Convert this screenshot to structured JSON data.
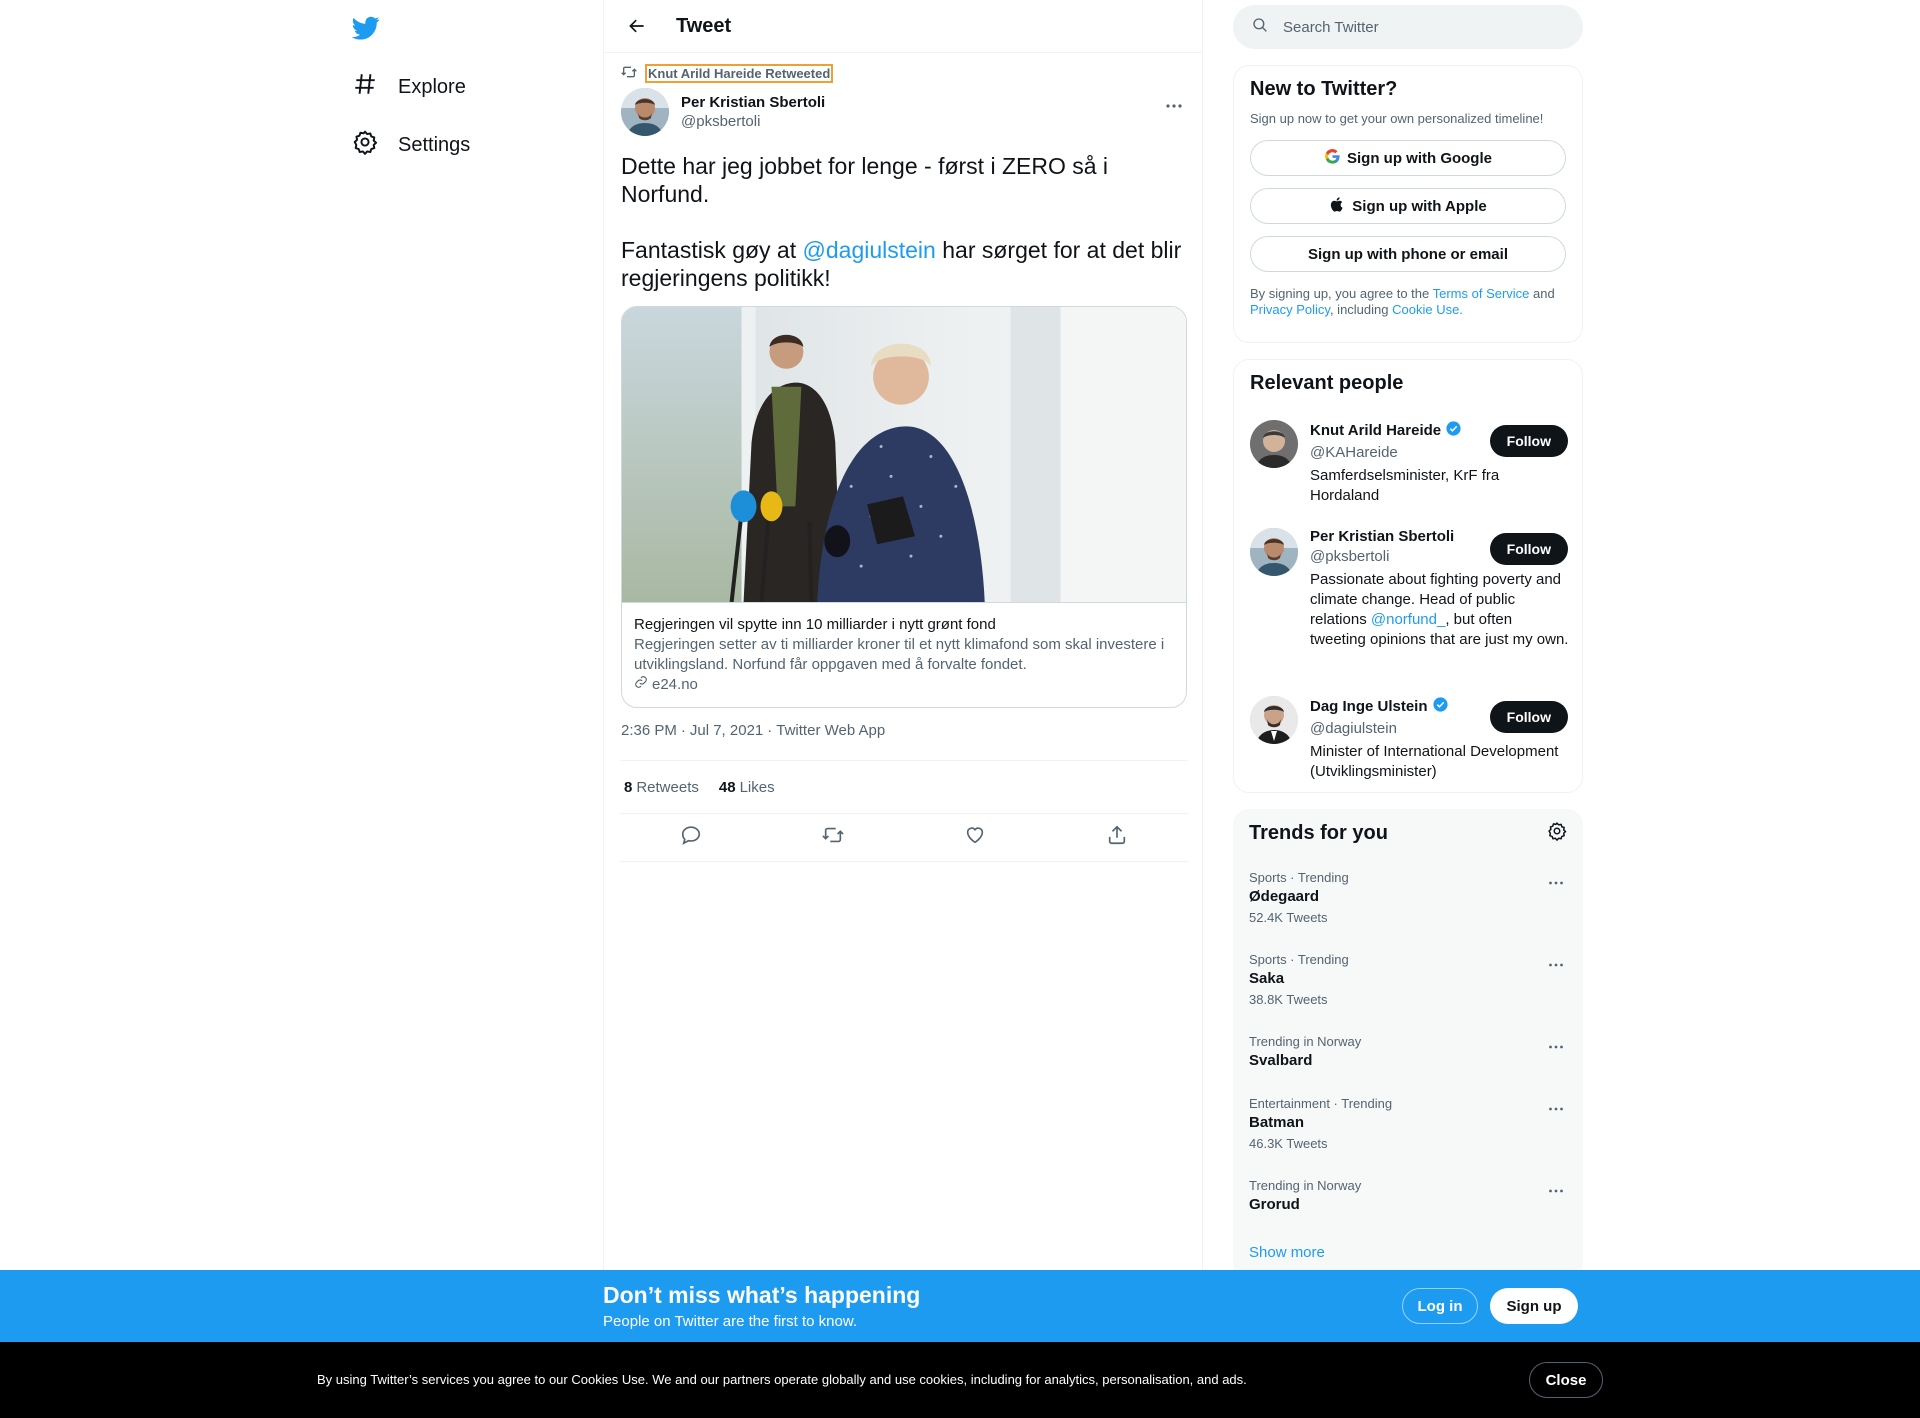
{
  "nav": {
    "explore_label": "Explore",
    "settings_label": "Settings"
  },
  "header": {
    "title": "Tweet"
  },
  "tweet": {
    "retweeted_by": "Knut Arild Hareide Retweeted",
    "author_name": "Per Kristian Sbertoli",
    "author_handle": "@pksbertoli",
    "text_line1": "Dette har jeg jobbet for lenge - først i ZERO så i Norfund.",
    "text_line2_before": "Fantastisk gøy at ",
    "text_mention": "@dagiulstein",
    "text_line2_after": " har sørget for at det blir regjeringens politikk!",
    "card": {
      "title": "Regjeringen vil spytte inn 10 milliarder i nytt grønt fond",
      "description": "Regjeringen setter av ti milliarder kroner til et nytt klimafond som skal investere i utviklingsland. Norfund får oppgaven med å forvalte fondet.",
      "domain": "e24.no"
    },
    "time": "2:36 PM",
    "date": "Jul 7, 2021",
    "source": "Twitter Web App",
    "separator": "·",
    "retweets_count": "8",
    "retweets_label": "Retweets",
    "likes_count": "48",
    "likes_label": "Likes"
  },
  "search": {
    "placeholder": "Search Twitter"
  },
  "new_to_twitter": {
    "title": "New to Twitter?",
    "subtitle": "Sign up now to get your own personalized timeline!",
    "google_label": "Sign up with Google",
    "apple_label": "Sign up with Apple",
    "phone_label": "Sign up with phone or email",
    "legal_1": "By signing up, you agree to the ",
    "tos": "Terms of Service",
    "legal_2": " and ",
    "privacy": "Privacy Policy",
    "legal_3": ", including ",
    "cookie": "Cookie Use."
  },
  "relevant_people": {
    "title": "Relevant people",
    "follow_label": "Follow",
    "people": [
      {
        "name": "Knut Arild Hareide",
        "handle": "@KAHareide",
        "verified": true,
        "bio": "Samferdselsminister, KrF fra Hordaland"
      },
      {
        "name": "Per Kristian Sbertoli",
        "handle": "@pksbertoli",
        "verified": false,
        "bio_before": "Passionate about fighting poverty and climate change. Head of public relations ",
        "bio_mention": "@norfund_",
        "bio_after": ", but often tweeting opinions that are just my own."
      },
      {
        "name": "Dag Inge Ulstein",
        "handle": "@dagiulstein",
        "verified": true,
        "bio": "Minister of International Development (Utviklingsminister)"
      }
    ]
  },
  "trends": {
    "title": "Trends for you",
    "show_more": "Show more",
    "items": [
      {
        "meta": "Sports · Trending",
        "name": "Ødegaard",
        "count": "52.4K Tweets"
      },
      {
        "meta": "Sports · Trending",
        "name": "Saka",
        "count": "38.8K Tweets"
      },
      {
        "meta": "Trending in Norway",
        "name": "Svalbard",
        "count": ""
      },
      {
        "meta": "Entertainment · Trending",
        "name": "Batman",
        "count": "46.3K Tweets"
      },
      {
        "meta": "Trending in Norway",
        "name": "Grorud",
        "count": ""
      }
    ]
  },
  "cta": {
    "title": "Don’t miss what’s happening",
    "subtitle": "People on Twitter are the first to know.",
    "login_label": "Log in",
    "signup_label": "Sign up"
  },
  "cookie_bar": {
    "text": "By using Twitter’s services you agree to our Cookies Use. We and our partners operate globally and use cookies, including for analytics, personalisation, and ads.",
    "close_label": "Close"
  },
  "colors": {
    "accent": "#1d9bf0",
    "text": "#0f1419",
    "secondary_text": "#536471",
    "border": "#eff3f4"
  }
}
